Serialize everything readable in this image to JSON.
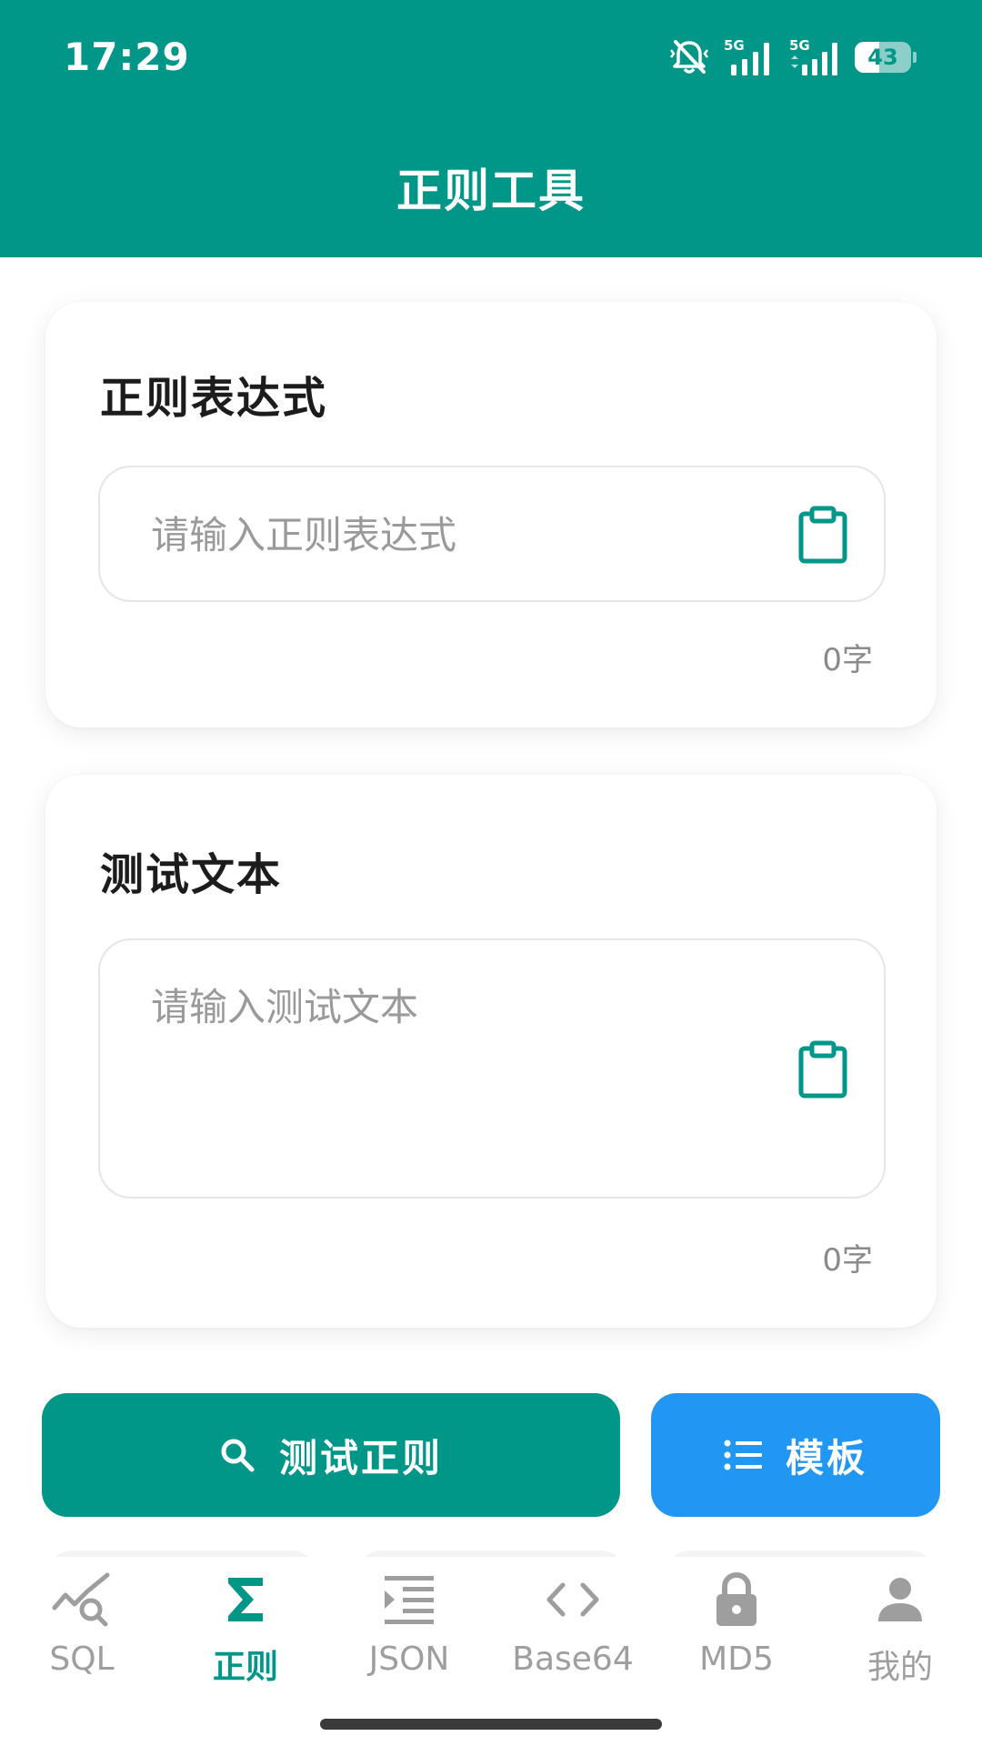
{
  "status": {
    "time": "17:29",
    "network_1": "5G",
    "network_2": "5G",
    "battery": "43",
    "battery_level_pct": 43
  },
  "header": {
    "title": "正则工具"
  },
  "regex_card": {
    "title": "正则表达式",
    "placeholder": "请输入正则表达式",
    "value": "",
    "counter": "0字"
  },
  "text_card": {
    "title": "测试文本",
    "placeholder": "请输入测试文本",
    "value": "",
    "counter": "0字"
  },
  "actions": {
    "test_label": "测试正则",
    "template_label": "模板"
  },
  "bottom_nav": {
    "items": [
      {
        "label": "SQL",
        "icon": "chart-search-icon",
        "active": false
      },
      {
        "label": "正则",
        "icon": "sigma-icon",
        "active": true
      },
      {
        "label": "JSON",
        "icon": "indent-list-icon",
        "active": false
      },
      {
        "label": "Base64",
        "icon": "code-brackets-icon",
        "active": false
      },
      {
        "label": "MD5",
        "icon": "lock-icon",
        "active": false
      },
      {
        "label": "我的",
        "icon": "person-icon",
        "active": false
      }
    ]
  },
  "colors": {
    "primary": "#009688",
    "secondary": "#2196f3",
    "inactive": "#9e9e9e"
  }
}
